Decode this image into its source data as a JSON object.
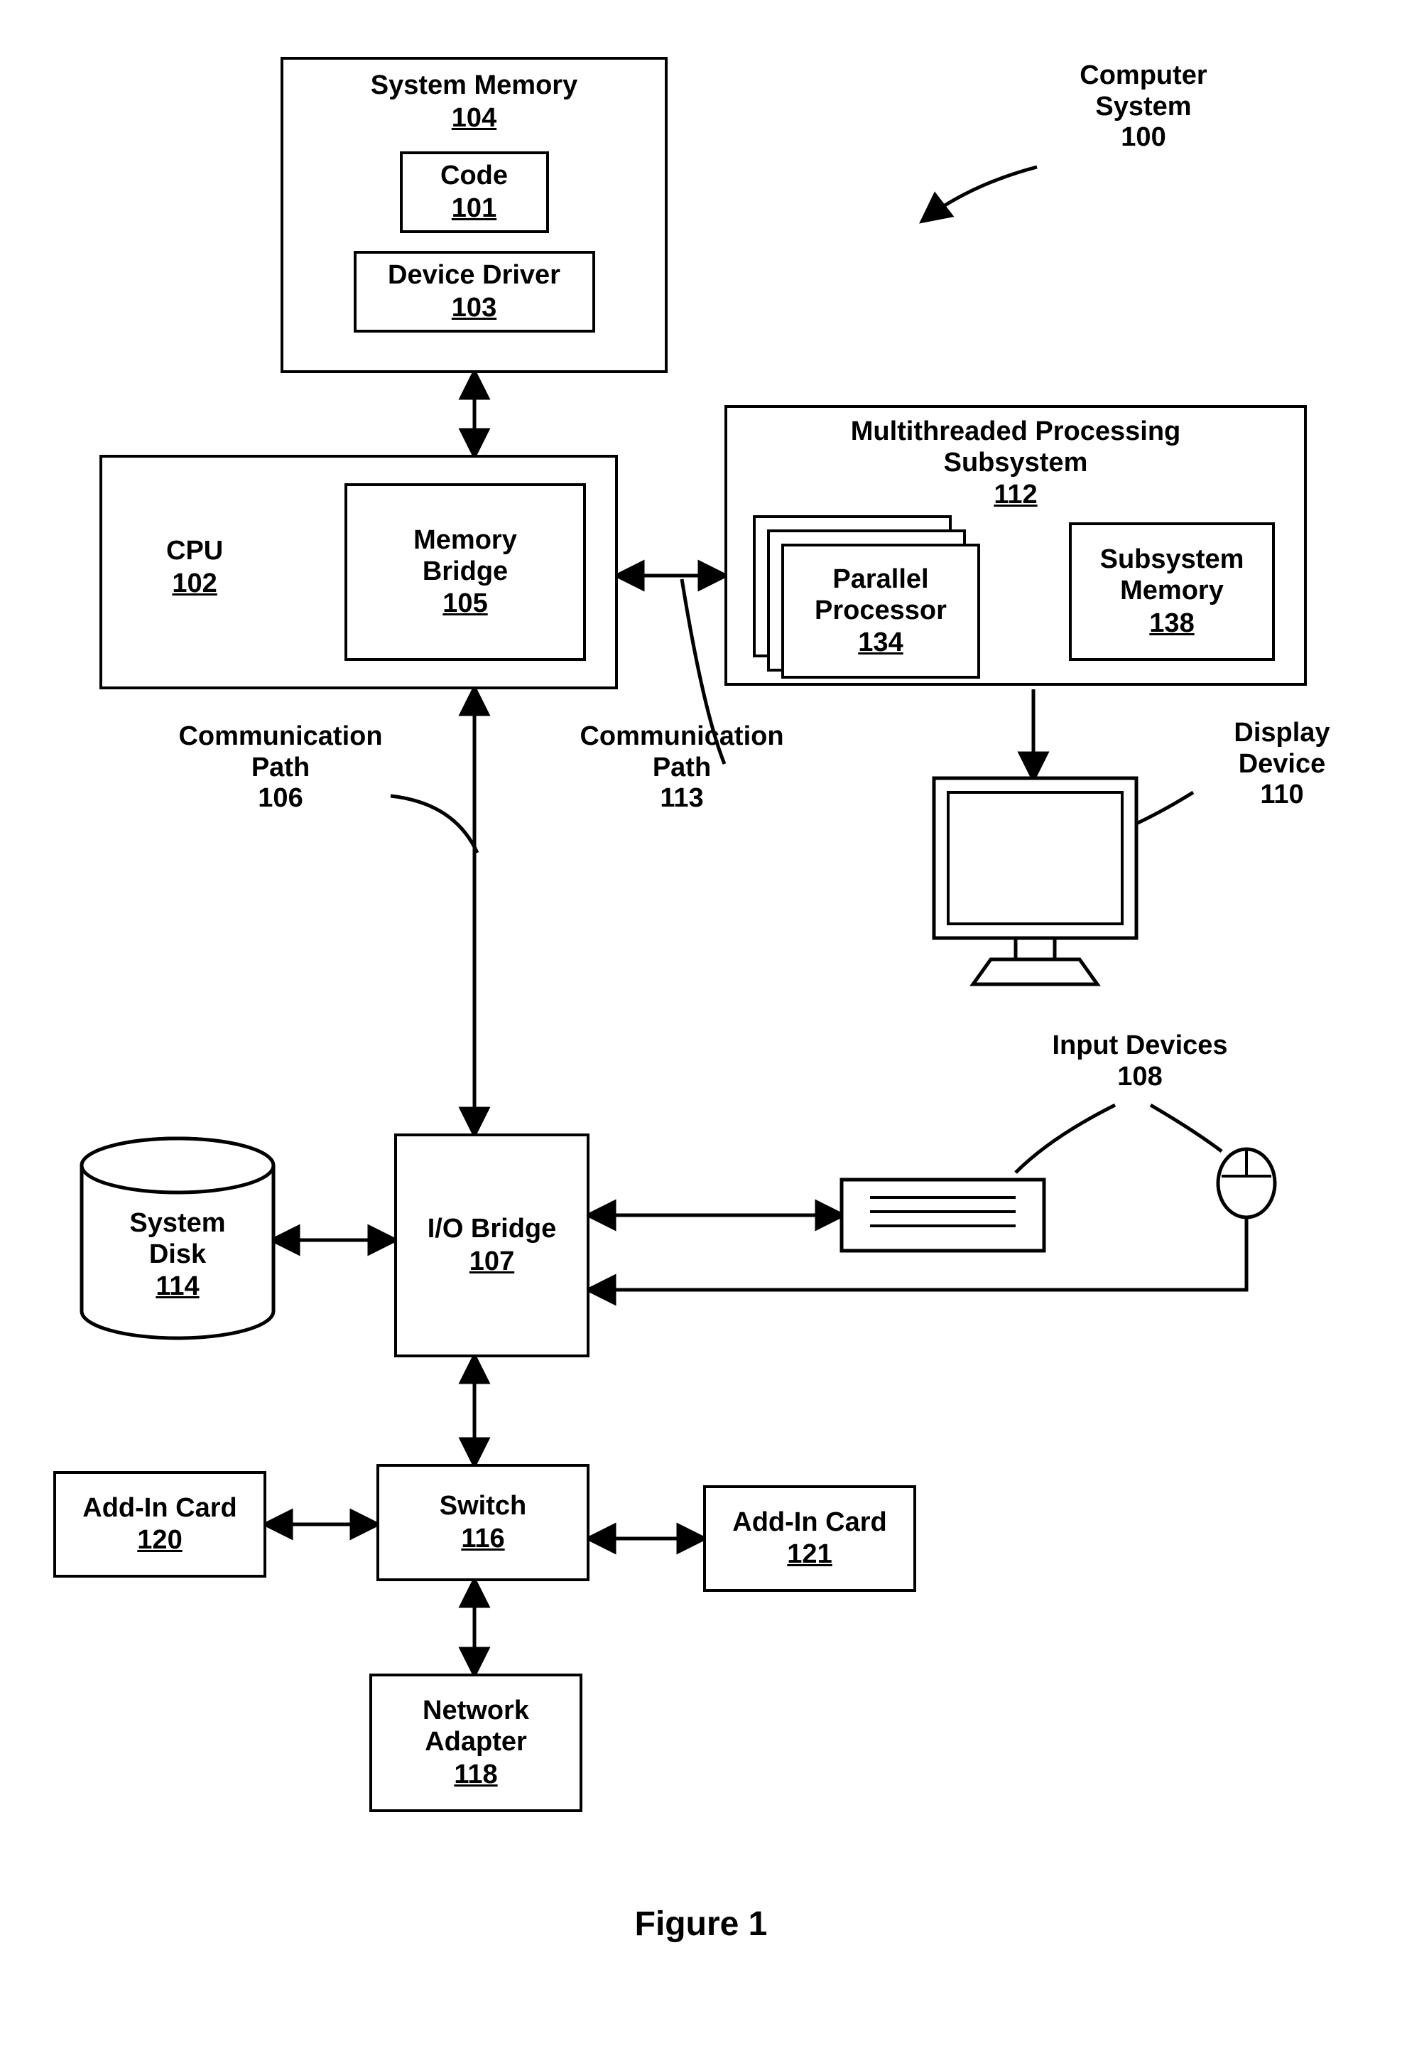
{
  "system_label": "Computer\nSystem",
  "system_num": "100",
  "system_memory": {
    "title": "System Memory",
    "num": "104"
  },
  "code": {
    "title": "Code",
    "num": "101"
  },
  "device_driver": {
    "title": "Device Driver",
    "num": "103"
  },
  "cpu": {
    "title": "CPU",
    "num": "102"
  },
  "memory_bridge": {
    "title": "Memory\nBridge",
    "num": "105"
  },
  "mtp": {
    "title": "Multithreaded Processing\nSubsystem",
    "num": "112"
  },
  "parallel_processor": {
    "title": "Parallel\nProcessor",
    "num": "134"
  },
  "subsystem_memory": {
    "title": "Subsystem\nMemory",
    "num": "138"
  },
  "display_device": {
    "title": "Display\nDevice",
    "num": "110"
  },
  "comm_path_a": {
    "title": "Communication\nPath",
    "num": "106"
  },
  "comm_path_b": {
    "title": "Communication\nPath",
    "num": "113"
  },
  "input_devices": {
    "title": "Input Devices",
    "num": "108"
  },
  "system_disk": {
    "title": "System\nDisk",
    "num": "114"
  },
  "io_bridge": {
    "title": "I/O Bridge",
    "num": "107"
  },
  "switch": {
    "title": "Switch",
    "num": "116"
  },
  "addin_left": {
    "title": "Add-In Card",
    "num": "120"
  },
  "addin_right": {
    "title": "Add-In Card",
    "num": "121"
  },
  "network_adapter": {
    "title": "Network\nAdapter",
    "num": "118"
  },
  "figure": "Figure 1"
}
